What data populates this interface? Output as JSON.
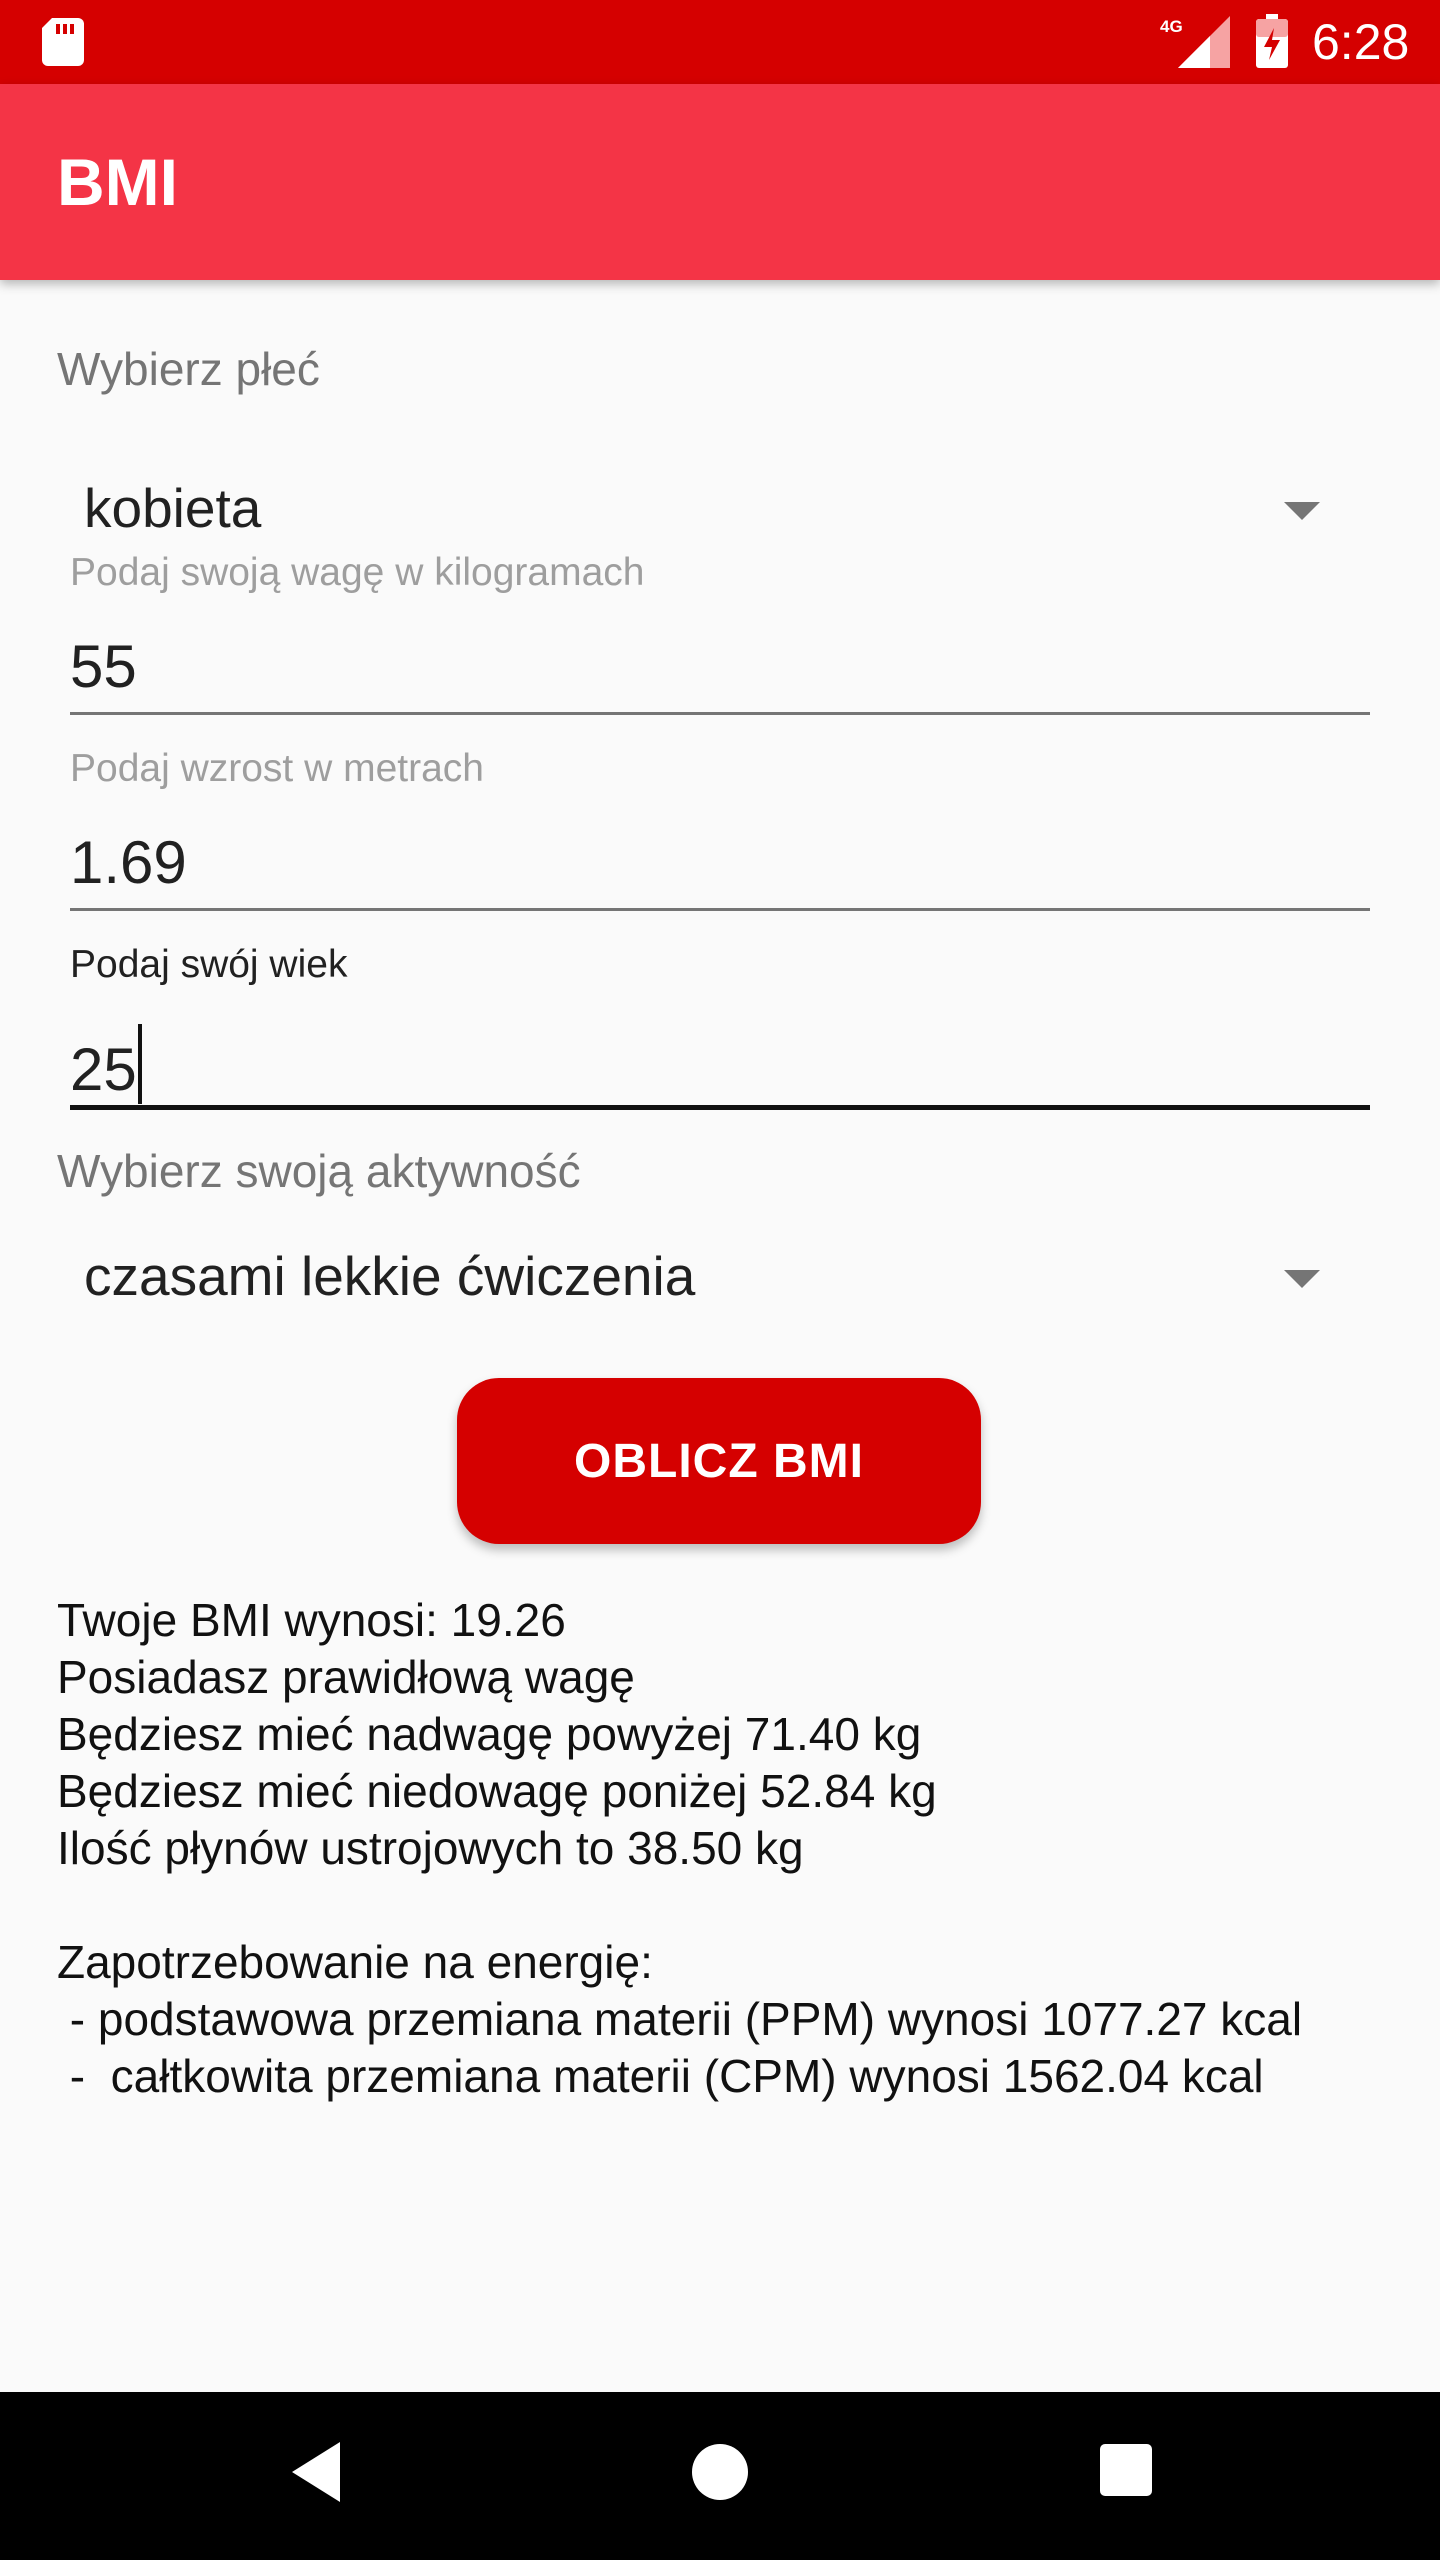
{
  "status_bar": {
    "time": "6:28",
    "network_label": "4G",
    "icons": [
      "sd-card-icon",
      "signal-4g-icon",
      "battery-charging-icon"
    ]
  },
  "app_bar": {
    "title": "BMI"
  },
  "form": {
    "gender_label": "Wybierz płeć",
    "gender_value": "kobieta",
    "weight": {
      "label": "Podaj swoją wagę w kilogramach",
      "value": "55"
    },
    "height": {
      "label": "Podaj wzrost w metrach",
      "value": "1.69"
    },
    "age": {
      "label": "Podaj swój wiek",
      "value": "25"
    },
    "activity_label": "Wybierz swoją aktywność",
    "activity_value": "czasami lekkie ćwiczenia"
  },
  "button": {
    "label": "OBLICZ BMI"
  },
  "results": {
    "lines": [
      "Twoje BMI wynosi: 19.26",
      "Posiadasz prawidłową wagę",
      "Będziesz mieć nadwagę powyżej 71.40 kg",
      "Będziesz mieć niedowagę poniżej 52.84 kg",
      "Ilość płynów ustrojowych to 38.50 kg",
      "",
      "Zapotrzebowanie na energię:",
      " - podstawowa przemiana materii (PPM) wynosi 1077.27 kcal",
      " -  całtkowita przemiana materii (CPM) wynosi 1562.04 kcal"
    ]
  },
  "colors": {
    "status_bar": "#d50000",
    "app_bar": "#f43446",
    "accent_button": "#d50000",
    "background": "#fafafa"
  },
  "nav_bar": {
    "icons": [
      "back-icon",
      "home-icon",
      "recents-icon"
    ]
  }
}
